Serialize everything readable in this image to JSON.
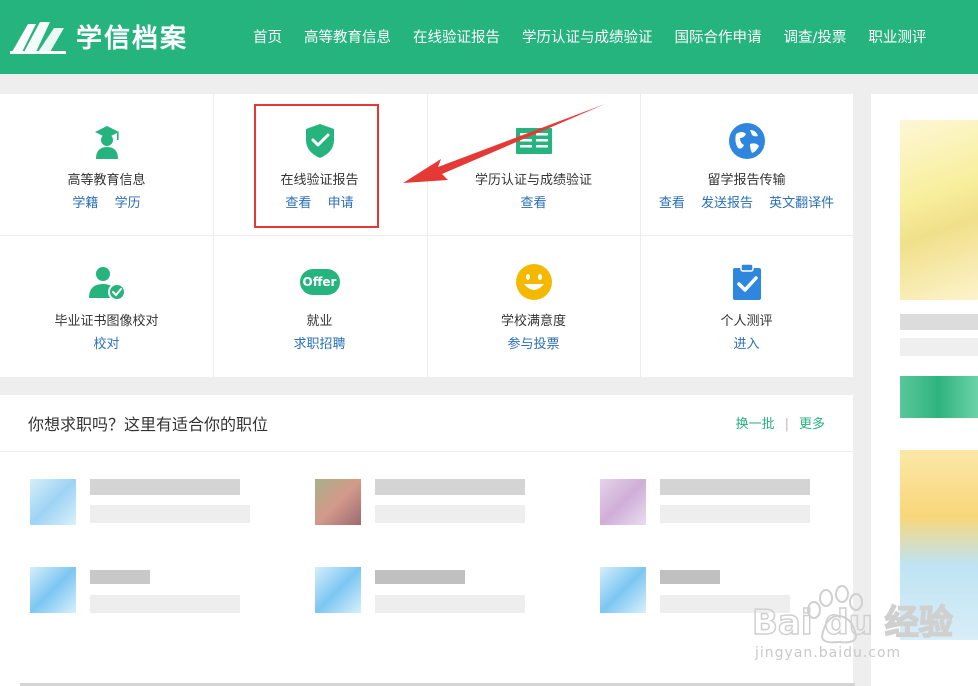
{
  "header": {
    "brand": "学信档案",
    "nav": [
      "首页",
      "高等教育信息",
      "在线验证报告",
      "学历认证与成绩验证",
      "国际合作申请",
      "调查/投票",
      "职业测评"
    ]
  },
  "services": [
    {
      "title": "高等教育信息",
      "links": [
        "学籍",
        "学历"
      ],
      "icon": "graduate-icon"
    },
    {
      "title": "在线验证报告",
      "links": [
        "查看",
        "申请"
      ],
      "icon": "shield-check-icon"
    },
    {
      "title": "学历认证与成绩验证",
      "links": [
        "查看"
      ],
      "icon": "certificate-icon"
    },
    {
      "title": "留学报告传输",
      "links": [
        "查看",
        "发送报告",
        "英文翻译件"
      ],
      "icon": "globe-icon"
    },
    {
      "title": "毕业证书图像校对",
      "links": [
        "校对"
      ],
      "icon": "user-check-icon"
    },
    {
      "title": "就业",
      "links": [
        "求职招聘"
      ],
      "icon": "offer-icon"
    },
    {
      "title": "学校满意度",
      "links": [
        "参与投票"
      ],
      "icon": "smiley-icon"
    },
    {
      "title": "个人测评",
      "links": [
        "进入"
      ],
      "icon": "clipboard-check-icon"
    }
  ],
  "offer_badge": "Offer",
  "jobs": {
    "title": "你想求职吗？这里有适合你的职位",
    "refresh": "换一批",
    "separator": "|",
    "more": "更多"
  },
  "watermark": {
    "logo": "Bai du 经验",
    "url": "jingyan.baidu.com"
  },
  "colors": {
    "brand": "#25b37e",
    "link": "#2a6fb5",
    "annotation": "#e53935",
    "smiley": "#f5b800",
    "globe": "#2e86de"
  }
}
